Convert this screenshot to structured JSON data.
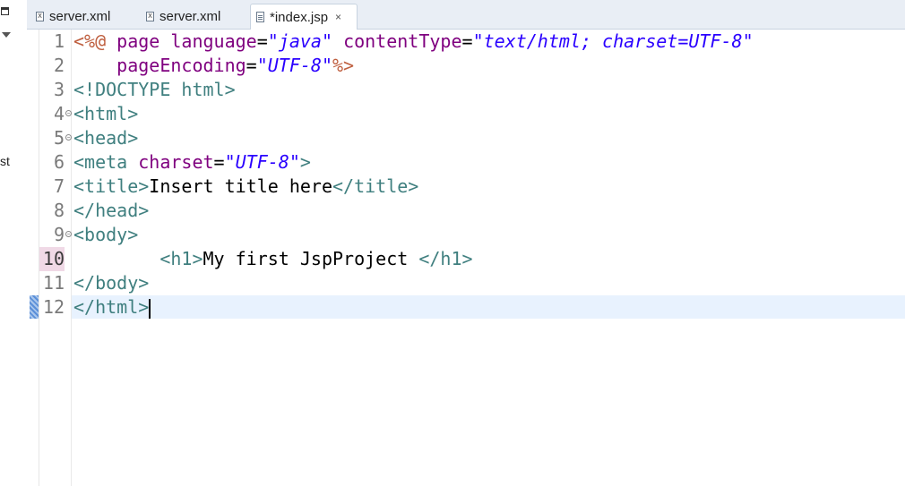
{
  "left_panel": {
    "cut_text": "st"
  },
  "tabs": [
    {
      "label": "server.xml",
      "icon": "xml-file-icon",
      "active": false
    },
    {
      "label": "server.xml",
      "icon": "xml-file-icon",
      "active": false
    },
    {
      "label": "*index.jsp",
      "icon": "jsp-file-icon",
      "active": true,
      "close": "×"
    }
  ],
  "editor": {
    "current_line": 10,
    "lines": [
      {
        "num": "1",
        "tokens": [
          {
            "t": "dir",
            "v": "<%@ "
          },
          {
            "t": "attr",
            "v": "page "
          },
          {
            "t": "attr",
            "v": "language"
          },
          {
            "t": "txt",
            "v": "="
          },
          {
            "t": "val",
            "v": "\"java\""
          },
          {
            "t": "txt",
            "v": " "
          },
          {
            "t": "attr",
            "v": "contentType"
          },
          {
            "t": "txt",
            "v": "="
          },
          {
            "t": "val",
            "v": "\"text/html; charset=UTF-8\""
          }
        ]
      },
      {
        "num": "2",
        "tokens": [
          {
            "t": "txt",
            "v": "    "
          },
          {
            "t": "attr",
            "v": "pageEncoding"
          },
          {
            "t": "txt",
            "v": "="
          },
          {
            "t": "val",
            "v": "\"UTF-8\""
          },
          {
            "t": "dir",
            "v": "%>"
          }
        ]
      },
      {
        "num": "3",
        "tokens": [
          {
            "t": "tag",
            "v": "<!DOCTYPE "
          },
          {
            "t": "tag",
            "v": "html"
          },
          {
            "t": "tag",
            "v": ">"
          }
        ]
      },
      {
        "num": "4",
        "fold": true,
        "tokens": [
          {
            "t": "tag",
            "v": "<html>"
          }
        ]
      },
      {
        "num": "5",
        "fold": true,
        "tokens": [
          {
            "t": "tag",
            "v": "<head>"
          }
        ]
      },
      {
        "num": "6",
        "tokens": [
          {
            "t": "tag",
            "v": "<meta "
          },
          {
            "t": "attr",
            "v": "charset"
          },
          {
            "t": "txt",
            "v": "="
          },
          {
            "t": "val",
            "v": "\"UTF-8\""
          },
          {
            "t": "tag",
            "v": ">"
          }
        ]
      },
      {
        "num": "7",
        "tokens": [
          {
            "t": "tag",
            "v": "<title>"
          },
          {
            "t": "txt",
            "v": "Insert title here"
          },
          {
            "t": "tag",
            "v": "</title>"
          }
        ]
      },
      {
        "num": "8",
        "tokens": [
          {
            "t": "tag",
            "v": "</head>"
          }
        ]
      },
      {
        "num": "9",
        "fold": true,
        "tokens": [
          {
            "t": "tag",
            "v": "<body>"
          }
        ]
      },
      {
        "num": "10",
        "tokens": [
          {
            "t": "txt",
            "v": "        "
          },
          {
            "t": "tag",
            "v": "<h1>"
          },
          {
            "t": "txt",
            "v": "My first JspProject "
          },
          {
            "t": "tag",
            "v": "</h1>"
          }
        ]
      },
      {
        "num": "11",
        "tokens": [
          {
            "t": "tag",
            "v": "</body>"
          }
        ]
      },
      {
        "num": "12",
        "caret": true,
        "tokens": [
          {
            "t": "tag",
            "v": "</html>"
          }
        ]
      }
    ]
  }
}
